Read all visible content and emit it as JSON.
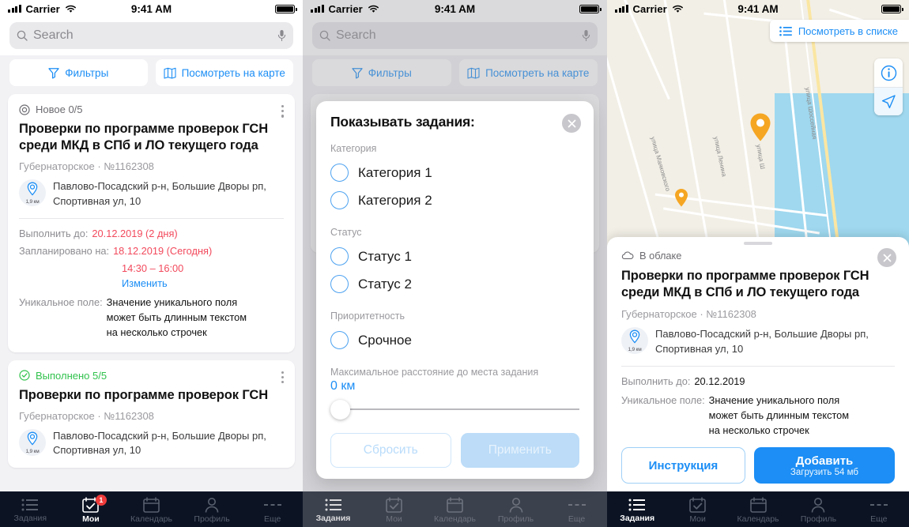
{
  "status_bar": {
    "carrier": "Carrier",
    "time": "9:41 AM"
  },
  "search": {
    "placeholder": "Search",
    "icon": "search-icon",
    "mic_icon": "microphone-icon"
  },
  "segmented": {
    "filters_label": "Фильтры",
    "map_label": "Посмотреть на карте"
  },
  "tabbar": {
    "items": [
      {
        "label": "Задания",
        "icon": "list-icon"
      },
      {
        "label": "Мои",
        "icon": "calendar-check-icon",
        "badge": "1"
      },
      {
        "label": "Календарь",
        "icon": "calendar-icon"
      },
      {
        "label": "Профиль",
        "icon": "person-icon"
      },
      {
        "label": "Еще",
        "icon": "ellipsis-icon"
      }
    ]
  },
  "screen1": {
    "active_tab": "Мои",
    "cards": [
      {
        "status": "Новое  0/5",
        "status_kind": "new",
        "title": "Проверки по программе проверок ГСН среди МКД в СПб и ЛО текущего года",
        "meta": "Губернаторское  ·  №1162308",
        "distance": "1,9 км",
        "address": "Павлово-Посадский р-н, Большие Дворы рп, Спортивная ул, 10",
        "due_key": "Выполнить до:",
        "due_value": "20.12.2019 (2 дня)",
        "planned_key": "Запланировано на:",
        "planned_value": "18.12.2019 (Сегодня)",
        "planned_time": "14:30 – 16:00",
        "change_link": "Изменить",
        "unique_key": "Уникальное поле:",
        "unique_value": "Значение уникального поля может быть длинным текстом на несколько строчек"
      },
      {
        "status": "Выполнено  5/5",
        "status_kind": "done",
        "title": "Проверки по программе проверок ГСН",
        "meta": "Губернаторское  ·  №1162308",
        "distance": "1,9 км",
        "address": "Павлово-Посадский р-н, Большие Дворы рп, Спортивная ул, 10"
      }
    ]
  },
  "screen2": {
    "active_tab": "Задания",
    "modal": {
      "title": "Показывать задания:",
      "close_icon": "close-icon",
      "groups": [
        {
          "label": "Категория",
          "options": [
            "Категория 1",
            "Категория 2"
          ]
        },
        {
          "label": "Статус",
          "options": [
            "Статус 1",
            "Статус 2"
          ]
        },
        {
          "label": "Приоритетность",
          "options": [
            "Срочное"
          ]
        }
      ],
      "distance_label": "Максимальное расстояние до места задания",
      "distance_value": "0 км",
      "reset_label": "Сбросить",
      "apply_label": "Применить"
    }
  },
  "screen3": {
    "active_tab": "Задания",
    "list_toggle_label": "Посмотреть в списке",
    "map": {
      "info_icon": "info-icon",
      "locate_icon": "navigation-arrow-icon",
      "streets": [
        "улица Маяковского",
        "улица Ленина",
        "улица Ш",
        "улица Шоссейная"
      ],
      "pins": 2
    },
    "sheet": {
      "status": "В облаке",
      "status_icon": "cloud-icon",
      "close_icon": "close-icon",
      "title": "Проверки по программе проверок ГСН среди МКД в СПб и ЛО текущего года",
      "meta": "Губернаторское  ·  №1162308",
      "distance": "1,9 км",
      "address": "Павлово-Посадский р-н, Большие Дворы рп, Спортивная ул, 10",
      "due_key": "Выполнить до:",
      "due_value": "20.12.2019",
      "unique_key": "Уникальное поле:",
      "unique_value": "Значение уникального поля может быть длинным текстом на несколько строчек",
      "instruction_label": "Инструкция",
      "add_label": "Добавить",
      "add_sub_label": "Загрузить 54 мб"
    }
  },
  "colors": {
    "accent": "#1c8ef5",
    "danger": "#f2495c",
    "success": "#31c24d",
    "tabbar": "#0c1424",
    "pin": "#f5a623"
  }
}
